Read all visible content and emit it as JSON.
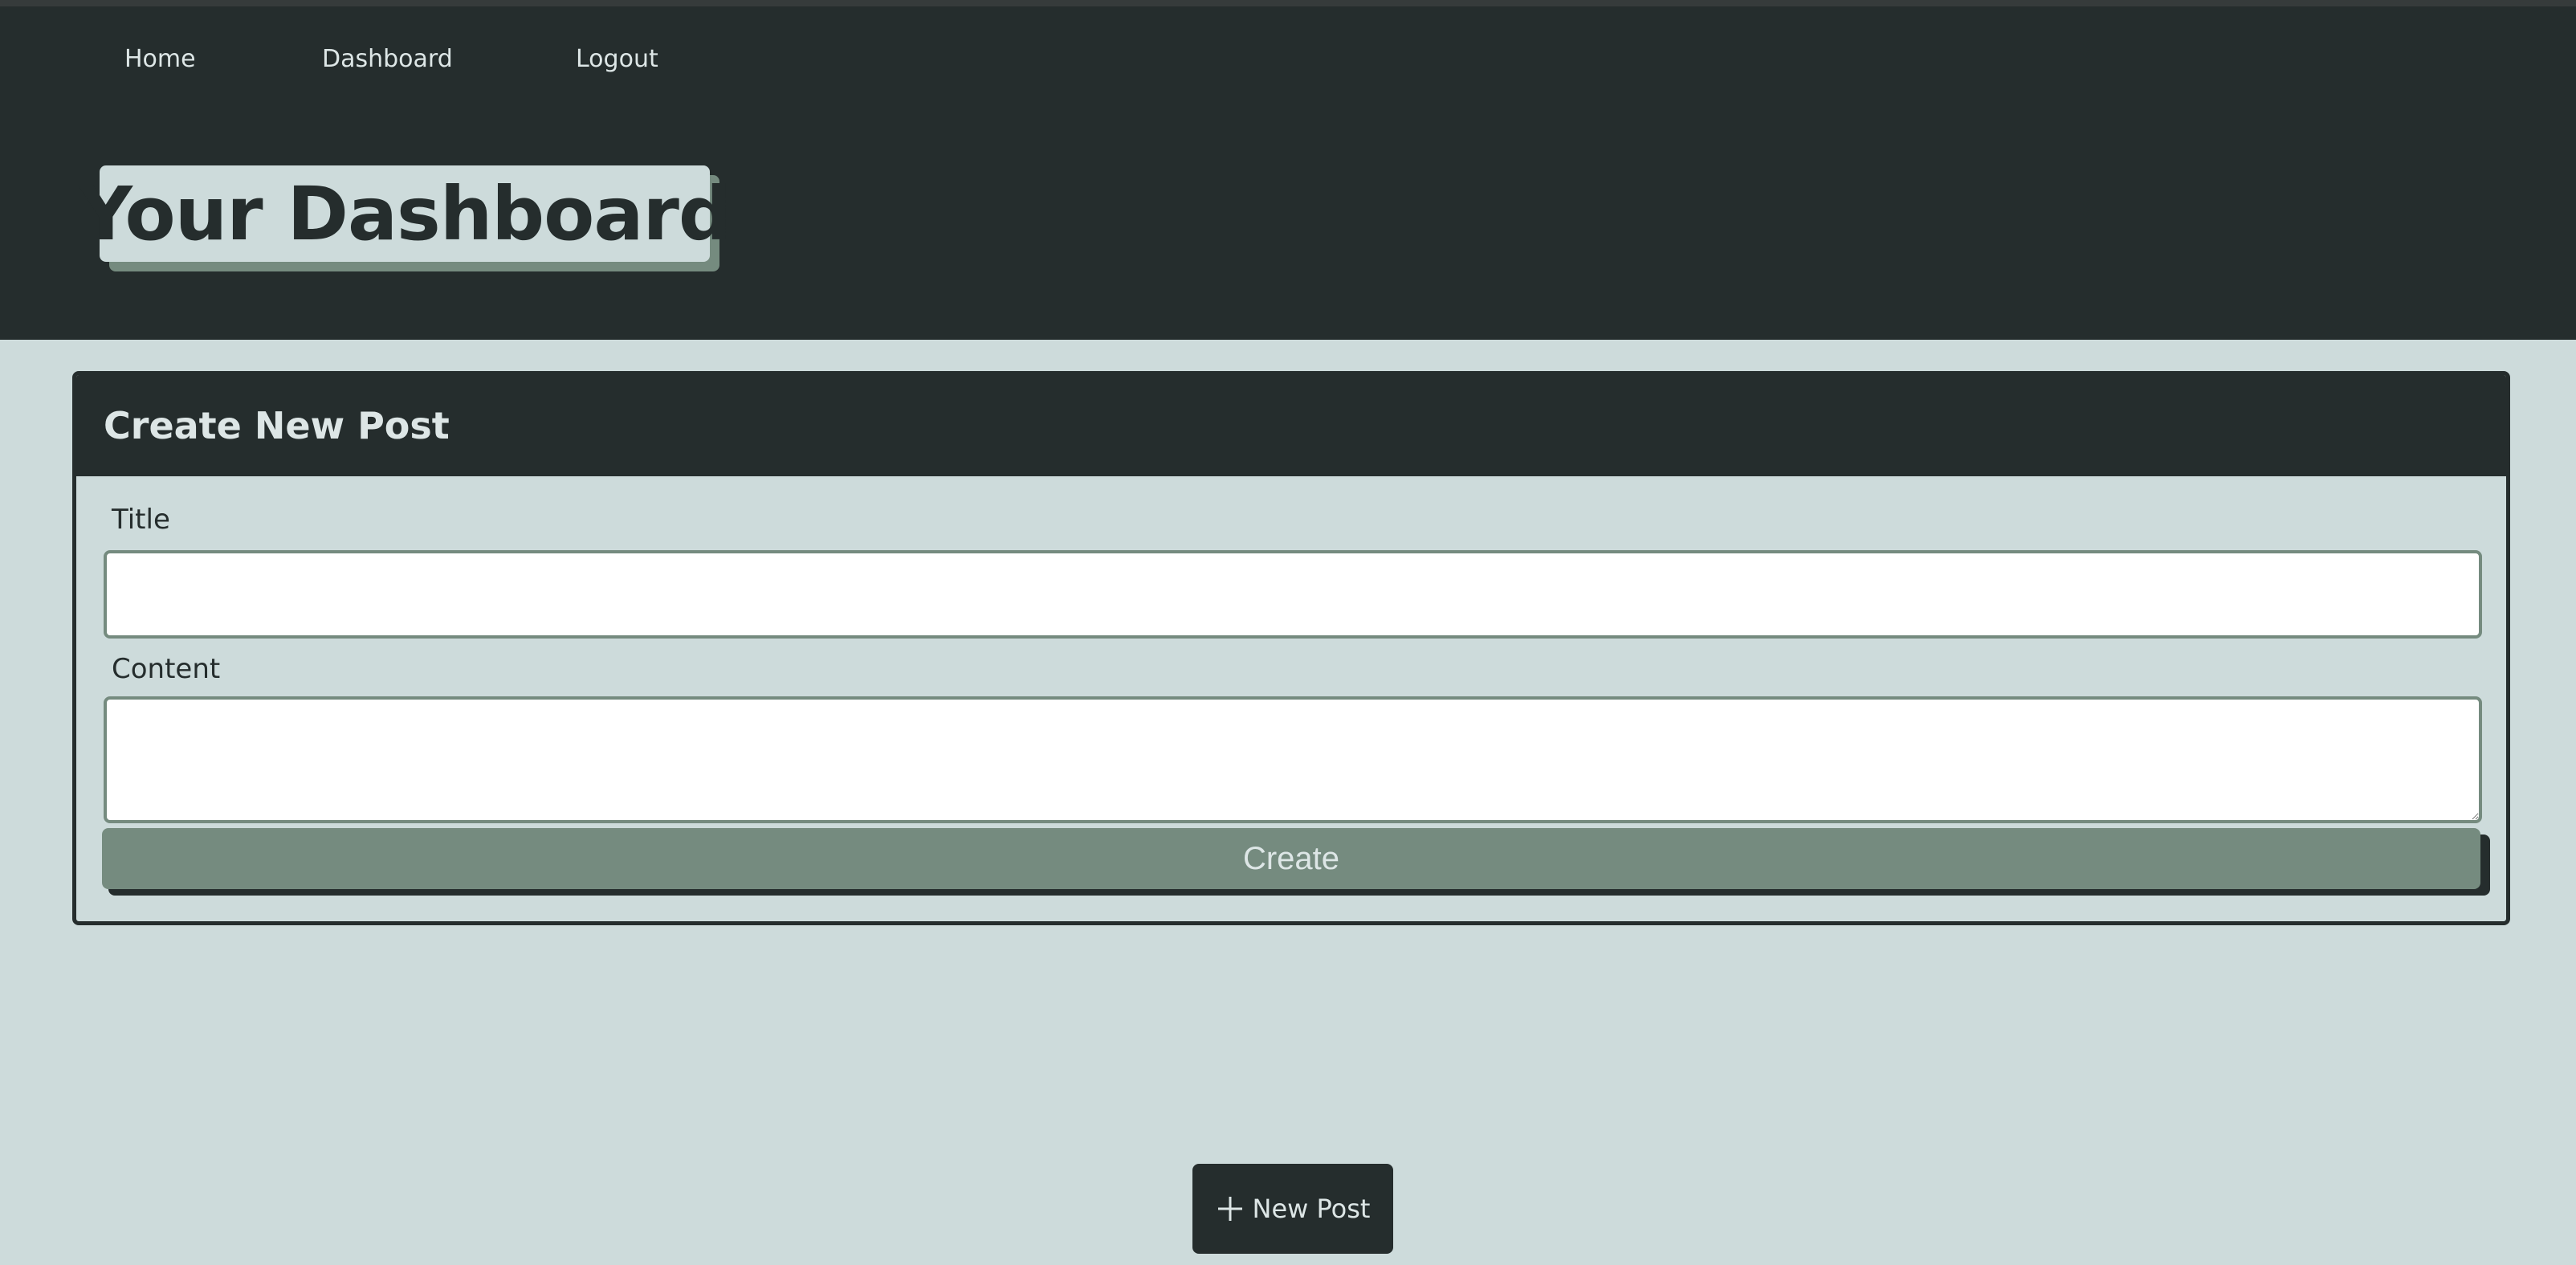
{
  "nav": {
    "items": [
      {
        "label": "Home"
      },
      {
        "label": "Dashboard"
      },
      {
        "label": "Logout"
      }
    ]
  },
  "header": {
    "title": "Your Dashboard"
  },
  "create_post": {
    "heading": "Create New Post",
    "title_label": "Title",
    "title_value": "",
    "content_label": "Content",
    "content_value": "",
    "submit_label": "Create"
  },
  "new_post_button": {
    "label": "New Post",
    "icon": "plus-icon"
  },
  "colors": {
    "dark": "#252d2d",
    "light": "#cddbdb",
    "accent": "#758b7f",
    "text_light": "#dde6e6"
  }
}
